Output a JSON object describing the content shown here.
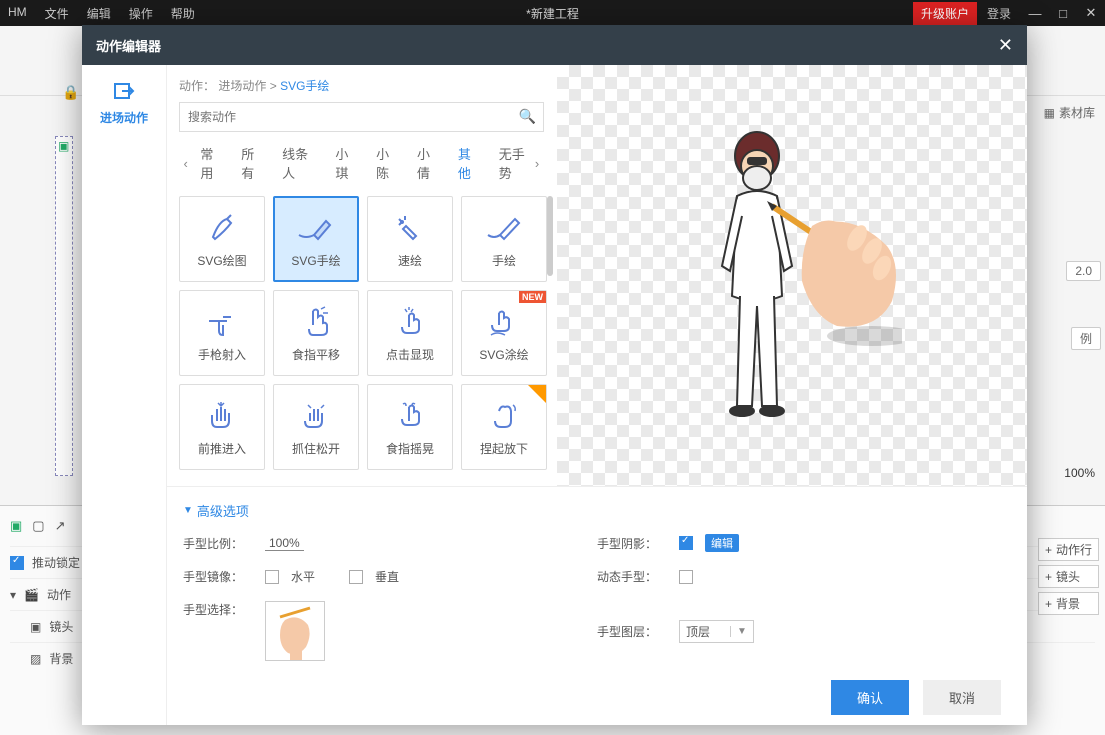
{
  "titlebar": {
    "menus": [
      "HM",
      "文件",
      "编辑",
      "操作",
      "帮助"
    ],
    "center": "*新建工程",
    "upgrade": "升级账户",
    "login": "登录"
  },
  "bg": {
    "matlib": "素材库",
    "val1": "2.0",
    "val2": "例",
    "zoom": "100%",
    "lock": "推动锁定",
    "rows": [
      "动作",
      "镜头",
      "背景"
    ],
    "right_btns": [
      "动作行",
      "镜头",
      "背景"
    ]
  },
  "modal": {
    "title": "动作编辑器",
    "sidebar_label": "进场动作",
    "breadcrumb_prefix": "动作：",
    "breadcrumb_mid": "进场动作",
    "breadcrumb_sep": ">",
    "breadcrumb_last": "SVG手绘",
    "search_placeholder": "搜索动作",
    "tabs": [
      "常用",
      "所有",
      "线条人",
      "小琪",
      "小陈",
      "小倩",
      "其他",
      "无手势"
    ],
    "active_tab": 6,
    "cards": [
      {
        "label": "SVG绘图",
        "icon": "draw"
      },
      {
        "label": "SVG手绘",
        "icon": "handdraw",
        "selected": true
      },
      {
        "label": "速绘",
        "icon": "wand"
      },
      {
        "label": "手绘",
        "icon": "pencil"
      },
      {
        "label": "手枪射入",
        "icon": "gun"
      },
      {
        "label": "食指平移",
        "icon": "fingermove"
      },
      {
        "label": "点击显现",
        "icon": "tap"
      },
      {
        "label": "SVG涂绘",
        "icon": "paint",
        "badge": "NEW"
      },
      {
        "label": "前推进入",
        "icon": "push"
      },
      {
        "label": "抓住松开",
        "icon": "grab"
      },
      {
        "label": "食指摇晃",
        "icon": "shake"
      },
      {
        "label": "捏起放下",
        "icon": "pinch",
        "corner": true
      }
    ],
    "options": {
      "header": "高级选项",
      "scale_label": "手型比例：",
      "scale_value": "100%",
      "shadow_label": "手型阴影：",
      "shadow_edit": "编辑",
      "mirror_label": "手型镜像：",
      "mirror_h": "水平",
      "mirror_v": "垂直",
      "dynamic_label": "动态手型：",
      "select_label": "手型选择：",
      "layer_label": "手型图层：",
      "layer_value": "顶层"
    },
    "confirm": "确认",
    "cancel": "取消"
  }
}
